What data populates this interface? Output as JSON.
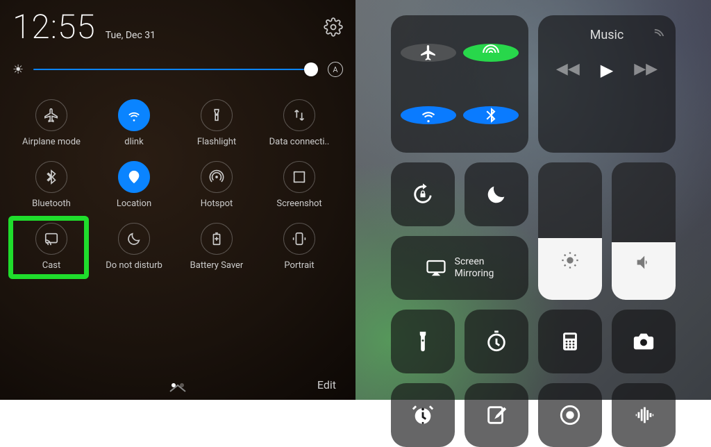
{
  "android": {
    "time": "12:55",
    "date": "Tue, Dec 31",
    "brightness_percent": 98,
    "auto_brightness_label": "A",
    "tiles": [
      {
        "key": "airplane",
        "label": "Airplane mode",
        "active": false
      },
      {
        "key": "wifi",
        "label": "dlink",
        "active": true
      },
      {
        "key": "flashlight",
        "label": "Flashlight",
        "active": false
      },
      {
        "key": "data",
        "label": "Data connecti..",
        "active": false
      },
      {
        "key": "bluetooth",
        "label": "Bluetooth",
        "active": false
      },
      {
        "key": "location",
        "label": "Location",
        "active": true
      },
      {
        "key": "hotspot",
        "label": "Hotspot",
        "active": false
      },
      {
        "key": "screenshot",
        "label": "Screenshot",
        "active": false
      },
      {
        "key": "cast",
        "label": "Cast",
        "active": false,
        "highlight": true
      },
      {
        "key": "dnd",
        "label": "Do not disturb",
        "active": false
      },
      {
        "key": "battery",
        "label": "Battery Saver",
        "active": false
      },
      {
        "key": "portrait",
        "label": "Portrait",
        "active": false
      }
    ],
    "edit_label": "Edit"
  },
  "ios": {
    "connectivity": [
      "airplane",
      "cellular",
      "wifi",
      "bluetooth"
    ],
    "music": {
      "title": "Music"
    },
    "mirror": {
      "line1": "Screen",
      "line2": "Mirroring"
    },
    "brightness_percent": 45,
    "volume_percent": 42,
    "small_buttons": [
      "flashlight",
      "timer",
      "calculator",
      "camera",
      "alarm",
      "notes",
      "record",
      "audio"
    ]
  },
  "colors": {
    "accent_android": "#0a84ff",
    "highlight": "#1fdd2c",
    "ios_green": "#28d74b",
    "ios_blue": "#0a7bff"
  }
}
